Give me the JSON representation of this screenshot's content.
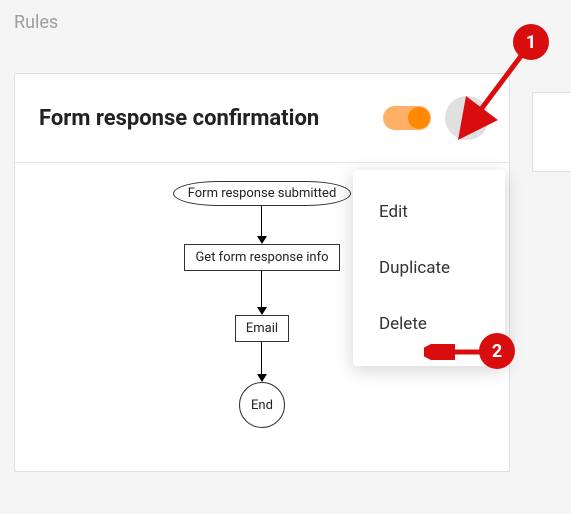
{
  "page": {
    "title": "Rules"
  },
  "card": {
    "title": "Form response confirmation",
    "toggle_on": true
  },
  "flow": {
    "node1": "Form response submitted",
    "node2": "Get form response info",
    "node3": "Email",
    "node4": "End"
  },
  "menu": {
    "items": [
      {
        "label": "Edit"
      },
      {
        "label": "Duplicate"
      },
      {
        "label": "Delete"
      }
    ]
  },
  "annotations": {
    "badge1": "1",
    "badge2": "2"
  }
}
